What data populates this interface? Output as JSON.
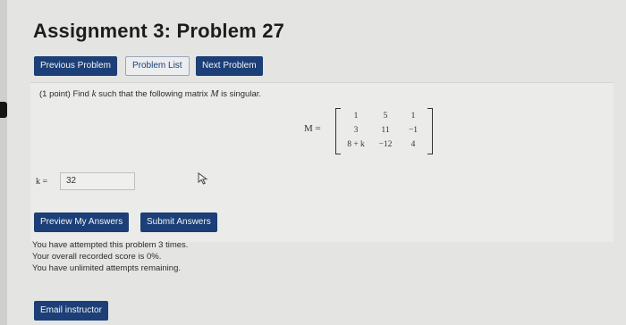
{
  "page": {
    "title": "Assignment 3: Problem 27"
  },
  "nav": {
    "previous_label": "Previous Problem",
    "list_label": "Problem List",
    "next_label": "Next Problem"
  },
  "problem": {
    "prompt_prefix": "(1 point) Find",
    "prompt_var": "k",
    "prompt_mid": "such that the following matrix",
    "prompt_matrix": "M",
    "prompt_suffix": "is singular.",
    "matrix_label": "M =",
    "matrix": [
      [
        "1",
        "5",
        "1"
      ],
      [
        "3",
        "11",
        "−1"
      ],
      [
        "8 + k",
        "−12",
        "4"
      ]
    ]
  },
  "answer": {
    "label": "k =",
    "value": "32"
  },
  "actions": {
    "preview_label": "Preview My Answers",
    "submit_label": "Submit Answers"
  },
  "status": {
    "line1": "You have attempted this problem 3 times.",
    "line2": "Your overall recorded score is 0%.",
    "line3": "You have unlimited attempts remaining."
  },
  "footer": {
    "email_label": "Email instructor"
  },
  "icons": {
    "cursor": "mouse-pointer-icon"
  },
  "colors": {
    "button_bg": "#1b3f76",
    "button_text": "#f2f4f8"
  }
}
